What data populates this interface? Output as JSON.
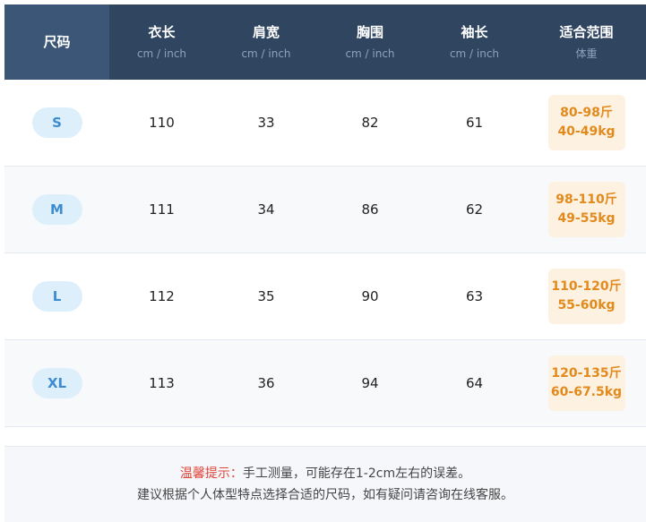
{
  "header": {
    "size_label": "尺码",
    "columns": [
      {
        "title": "衣长",
        "unit": "cm / inch"
      },
      {
        "title": "肩宽",
        "unit": "cm / inch"
      },
      {
        "title": "胸围",
        "unit": "cm / inch"
      },
      {
        "title": "袖长",
        "unit": "cm / inch"
      },
      {
        "title": "适合范围",
        "unit": "体重"
      }
    ]
  },
  "rows": [
    {
      "size": "S",
      "length": "110",
      "shoulder": "33",
      "chest": "82",
      "sleeve": "61",
      "fit_jin": "80-98斤",
      "fit_kg": "40-49kg"
    },
    {
      "size": "M",
      "length": "111",
      "shoulder": "34",
      "chest": "86",
      "sleeve": "62",
      "fit_jin": "98-110斤",
      "fit_kg": "49-55kg"
    },
    {
      "size": "L",
      "length": "112",
      "shoulder": "35",
      "chest": "90",
      "sleeve": "63",
      "fit_jin": "110-120斤",
      "fit_kg": "55-60kg"
    },
    {
      "size": "XL",
      "length": "113",
      "shoulder": "36",
      "chest": "94",
      "sleeve": "64",
      "fit_jin": "120-135斤",
      "fit_kg": "60-67.5kg"
    }
  ],
  "footer": {
    "tip_label": "温馨提示：",
    "tip_line1": "手工测量，可能存在1-2cm左右的误差。",
    "tip_line2": "建议根据个人体型特点选择合适的尺码，如有疑问请咨询在线客服。"
  },
  "colors": {
    "header_bg": "#2f4560",
    "size_header_bg": "#3c5677",
    "size_pill_bg": "#deeffc",
    "size_pill_text": "#3d8cd0",
    "fit_bg": "#fdf1e2",
    "fit_text": "#e28a1c",
    "tip_label": "#e0453a"
  }
}
